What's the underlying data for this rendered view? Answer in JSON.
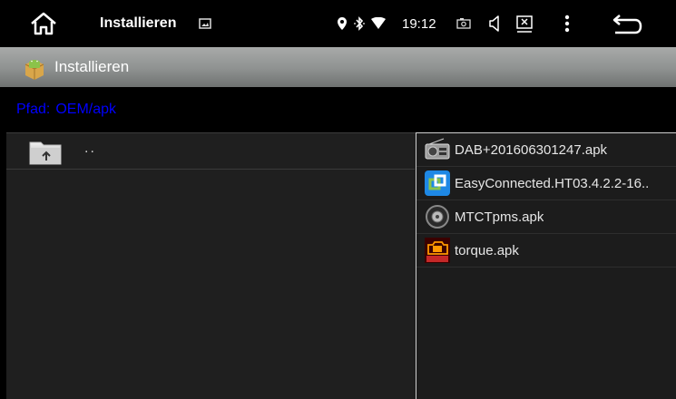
{
  "status_bar": {
    "title": "Installieren",
    "time": "19:12",
    "icons": [
      "home-icon",
      "image-icon",
      "location-icon",
      "bluetooth-icon",
      "wifi-icon",
      "camera-icon",
      "volume-icon",
      "close-box-icon",
      "overflow-menu-icon",
      "back-icon"
    ]
  },
  "header": {
    "title": "Installieren",
    "icon": "android-package-icon"
  },
  "path": {
    "label": "Pfad:",
    "value": "OEM/apk",
    "color": "#0000ff"
  },
  "left_panel": {
    "items": [
      {
        "label": "..",
        "icon": "folder-up-icon"
      }
    ]
  },
  "file_list": {
    "items": [
      {
        "name": "DAB+201606301247.apk",
        "icon": "radio-icon"
      },
      {
        "name": "EasyConnected.HT03.4.2.2-16..",
        "icon": "easyconnected-icon"
      },
      {
        "name": "MTCTpms.apk",
        "icon": "tire-icon"
      },
      {
        "name": "torque.apk",
        "icon": "obd-check-icon"
      }
    ]
  }
}
